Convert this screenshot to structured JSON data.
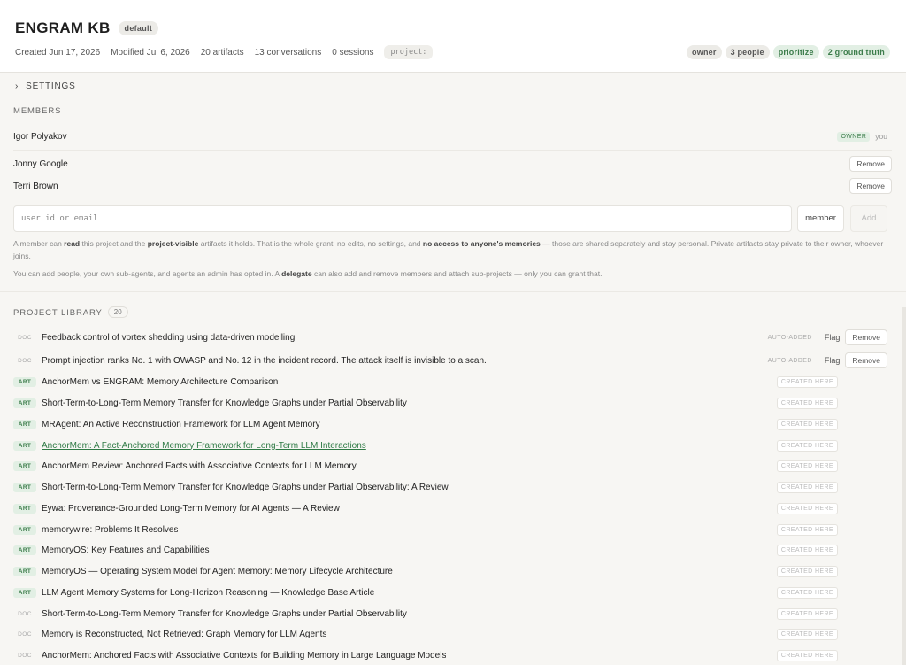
{
  "header": {
    "title": "ENGRAM KB",
    "default_badge": "default",
    "created": "Created Jun 17, 2026",
    "modified": "Modified Jul 6, 2026",
    "artifacts": "20 artifacts",
    "conversations": "13 conversations",
    "sessions": "0 sessions",
    "project_tag": "project:",
    "badges": [
      "owner",
      "3 people",
      "prioritize",
      "2 ground truth"
    ]
  },
  "settings": {
    "label": "SETTINGS",
    "icon": "chevron-right-icon"
  },
  "members": {
    "label": "MEMBERS",
    "owner": {
      "name": "Igor Polyakov",
      "tag": "OWNER",
      "you": "you"
    },
    "others": [
      {
        "name": "Jonny Google",
        "action": "Remove"
      },
      {
        "name": "Terri Brown",
        "action": "Remove"
      }
    ],
    "input_placeholder": "user id or email",
    "role": "member",
    "add_label": "Add"
  },
  "library": {
    "label": "PROJECT LIBRARY",
    "count": "20",
    "auto_label": "AUTO-ADDED",
    "flag_label": "Flag",
    "remove_label": "Remove",
    "created_label": "CREATED HERE",
    "items": [
      {
        "kind": "DOC",
        "title": "Feedback control of vortex shedding using data-driven modelling",
        "status": "auto"
      },
      {
        "kind": "DOC",
        "title": "Prompt injection ranks No. 1 with OWASP and No. 12 in the incident record. The attack itself is invisible to a scan.",
        "status": "auto"
      },
      {
        "kind": "ART",
        "title": "AnchorMem vs ENGRAM: Memory Architecture Comparison",
        "status": "created"
      },
      {
        "kind": "ART",
        "title": "Short-Term-to-Long-Term Memory Transfer for Knowledge Graphs under Partial Observability",
        "status": "created"
      },
      {
        "kind": "ART",
        "title": "MRAgent: An Active Reconstruction Framework for LLM Agent Memory",
        "status": "created"
      },
      {
        "kind": "ART",
        "title": "AnchorMem: A Fact-Anchored Memory Framework for Long-Term LLM Interactions",
        "status": "created",
        "link": true
      },
      {
        "kind": "ART",
        "title": "AnchorMem Review: Anchored Facts with Associative Contexts for LLM Memory",
        "status": "created"
      },
      {
        "kind": "ART",
        "title": "Short-Term-to-Long-Term Memory Transfer for Knowledge Graphs under Partial Observability: A Review",
        "status": "created"
      },
      {
        "kind": "ART",
        "title": "Eywa: Provenance-Grounded Long-Term Memory for AI Agents — A Review",
        "status": "created"
      },
      {
        "kind": "ART",
        "title": "memorywire: Problems It Resolves",
        "status": "created"
      },
      {
        "kind": "ART",
        "title": "MemoryOS: Key Features and Capabilities",
        "status": "created"
      },
      {
        "kind": "ART",
        "title": "MemoryOS — Operating System Model for Agent Memory: Memory Lifecycle Architecture",
        "status": "created"
      },
      {
        "kind": "ART",
        "title": "LLM Agent Memory Systems for Long-Horizon Reasoning — Knowledge Base Article",
        "status": "created"
      },
      {
        "kind": "DOC",
        "title": "Short-Term-to-Long-Term Memory Transfer for Knowledge Graphs under Partial Observability",
        "status": "created"
      },
      {
        "kind": "DOC",
        "title": "Memory is Reconstructed, Not Retrieved: Graph Memory for LLM Agents",
        "status": "created"
      },
      {
        "kind": "DOC",
        "title": "AnchorMem: Anchored Facts with Associative Contexts for Building Memory in Large Language Models",
        "status": "created"
      }
    ]
  },
  "colors": {
    "accent_green": "#3b7c4a",
    "green_bg": "#e2efe4",
    "page_bg": "#f7f6f3"
  }
}
